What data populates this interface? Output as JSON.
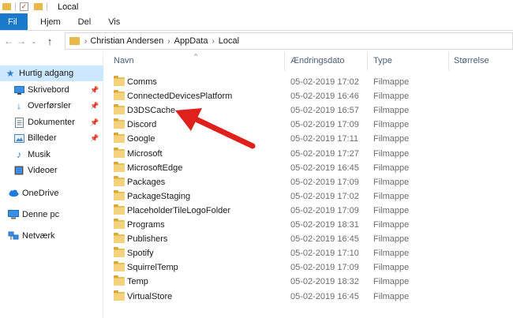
{
  "window": {
    "title": "Local"
  },
  "ribbon": {
    "tabs": [
      "Fil",
      "Hjem",
      "Del",
      "Vis"
    ]
  },
  "address": {
    "crumbs": [
      "Christian Andersen",
      "AppData",
      "Local"
    ]
  },
  "sidebar": {
    "items": [
      {
        "label": "Hurtig adgang",
        "icon": "star-icon"
      },
      {
        "label": "Skrivebord",
        "icon": "desktop-icon"
      },
      {
        "label": "Overførsler",
        "icon": "download-icon"
      },
      {
        "label": "Dokumenter",
        "icon": "document-icon"
      },
      {
        "label": "Billeder",
        "icon": "pictures-icon"
      },
      {
        "label": "Musik",
        "icon": "music-icon"
      },
      {
        "label": "Videoer",
        "icon": "video-icon"
      },
      {
        "label": "OneDrive",
        "icon": "cloud-icon"
      },
      {
        "label": "Denne pc",
        "icon": "computer-icon"
      },
      {
        "label": "Netværk",
        "icon": "network-icon"
      }
    ]
  },
  "columns": {
    "name": "Navn",
    "date": "Ændringsdato",
    "type": "Type",
    "size": "Størrelse"
  },
  "files": [
    {
      "name": "Comms",
      "date": "05-02-2019 17:02",
      "type": "Filmappe"
    },
    {
      "name": "ConnectedDevicesPlatform",
      "date": "05-02-2019 16:46",
      "type": "Filmappe"
    },
    {
      "name": "D3DSCache",
      "date": "05-02-2019 16:57",
      "type": "Filmappe"
    },
    {
      "name": "Discord",
      "date": "05-02-2019 17:09",
      "type": "Filmappe"
    },
    {
      "name": "Google",
      "date": "05-02-2019 17:11",
      "type": "Filmappe"
    },
    {
      "name": "Microsoft",
      "date": "05-02-2019 17:27",
      "type": "Filmappe"
    },
    {
      "name": "MicrosoftEdge",
      "date": "05-02-2019 16:45",
      "type": "Filmappe"
    },
    {
      "name": "Packages",
      "date": "05-02-2019 17:09",
      "type": "Filmappe"
    },
    {
      "name": "PackageStaging",
      "date": "05-02-2019 17:02",
      "type": "Filmappe"
    },
    {
      "name": "PlaceholderTileLogoFolder",
      "date": "05-02-2019 17:09",
      "type": "Filmappe"
    },
    {
      "name": "Programs",
      "date": "05-02-2019 18:31",
      "type": "Filmappe"
    },
    {
      "name": "Publishers",
      "date": "05-02-2019 16:45",
      "type": "Filmappe"
    },
    {
      "name": "Spotify",
      "date": "05-02-2019 17:10",
      "type": "Filmappe"
    },
    {
      "name": "SquirrelTemp",
      "date": "05-02-2019 17:09",
      "type": "Filmappe"
    },
    {
      "name": "Temp",
      "date": "05-02-2019 18:32",
      "type": "Filmappe"
    },
    {
      "name": "VirtualStore",
      "date": "05-02-2019 16:45",
      "type": "Filmappe"
    }
  ],
  "colors": {
    "file_tab": "#1979ca",
    "selection": "#cce8ff",
    "folder": "#f3d27b",
    "annotation_arrow": "#e0201b"
  }
}
